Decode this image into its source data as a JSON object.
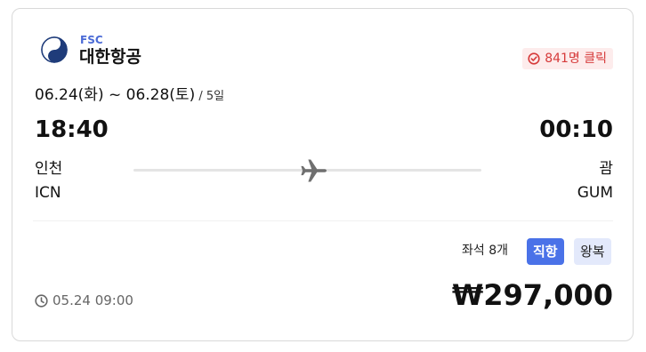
{
  "airline": {
    "type": "FSC",
    "name": "대한항공",
    "logo_icon": "korean-air-taegeuk-logo"
  },
  "clicks": {
    "label": "841명 클릭",
    "icon": "check-circle-icon",
    "color": "#d63a3a"
  },
  "schedule": {
    "dates": "06.24(화) ~ 06.28(토)",
    "duration": " / 5일"
  },
  "departure": {
    "time": "18:40",
    "city": "인천",
    "code": "ICN"
  },
  "arrival": {
    "time": "00:10",
    "city": "괌",
    "code": "GUM"
  },
  "route": {
    "icon": "airplane-icon"
  },
  "fare": {
    "seats": "좌석 8개",
    "tags": [
      "직항",
      "왕복"
    ],
    "price": "₩297,000",
    "posted_time": "05.24 09:00",
    "posted_icon": "clock-icon",
    "accent_color": "#4a72e8"
  }
}
